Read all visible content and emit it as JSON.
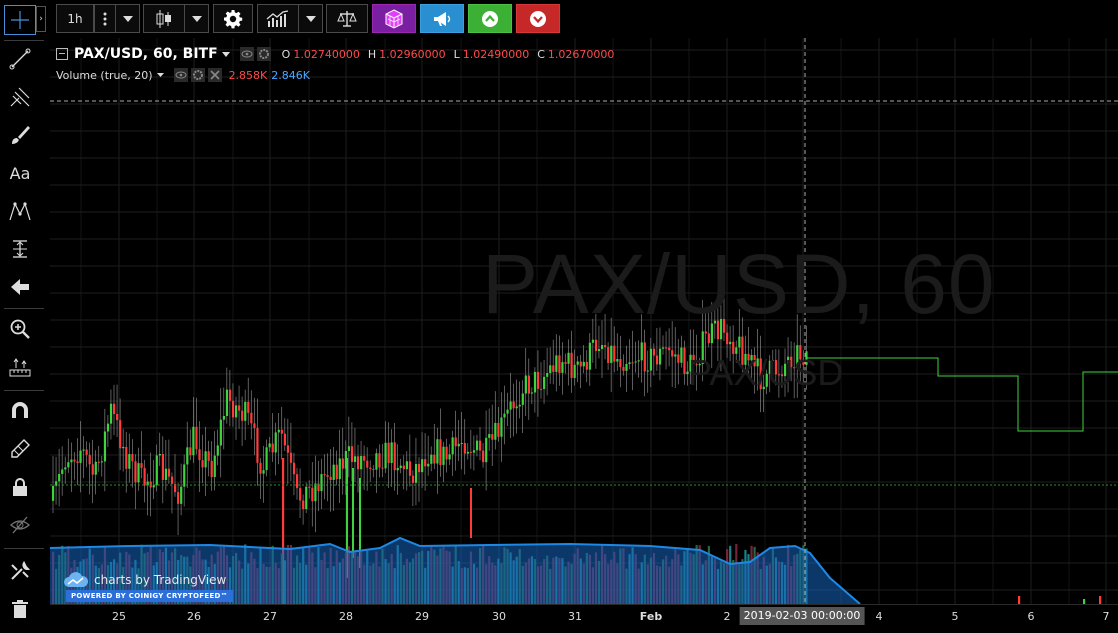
{
  "toolbar": {
    "interval": "1h",
    "buttons": [
      "interval-menu",
      "chart-style",
      "settings",
      "indicators",
      "compare",
      "cube-app",
      "announcements",
      "buy",
      "sell"
    ]
  },
  "legend": {
    "symbol": "PAX/USD, 60, BITF",
    "o_label": "O",
    "o_value": "1.02740000",
    "h_label": "H",
    "h_value": "1.02960000",
    "l_label": "L",
    "l_value": "1.02490000",
    "c_label": "C",
    "c_value": "1.02670000",
    "volume_name": "Volume (true, 20)",
    "volume_v1": "2.858K",
    "volume_v2": "2.846K"
  },
  "watermark": {
    "main": "PAX/USD, 60",
    "sub": "PAX/USD"
  },
  "time_axis": {
    "labels": [
      "25",
      "26",
      "27",
      "28",
      "29",
      "30",
      "31",
      "Feb",
      "2",
      "4",
      "5",
      "6",
      "7"
    ],
    "cursor": "2019-02-03 00:00:00"
  },
  "brand": {
    "main": "charts by TradingView",
    "powered": "POWERED BY COINIGY CRYPTOFEED™"
  },
  "colors": {
    "up": "#3fd43f",
    "down": "#ff3b3b",
    "grid": "#1e1e1e",
    "volume_area": "#1565c0",
    "volume_bar": "#2196a6",
    "accent": "#4a90d9"
  },
  "chart_data": {
    "type": "candlestick",
    "x_labels": [
      "25",
      "26",
      "27",
      "28",
      "29",
      "30",
      "31",
      "Feb",
      "2",
      "2019-02-03 00:00:00",
      "4",
      "5",
      "6",
      "7"
    ],
    "ohlc_last": {
      "open": 1.0274,
      "high": 1.0296,
      "low": 1.0249,
      "close": 1.0267
    },
    "volume_last": [
      2858,
      2846
    ]
  }
}
